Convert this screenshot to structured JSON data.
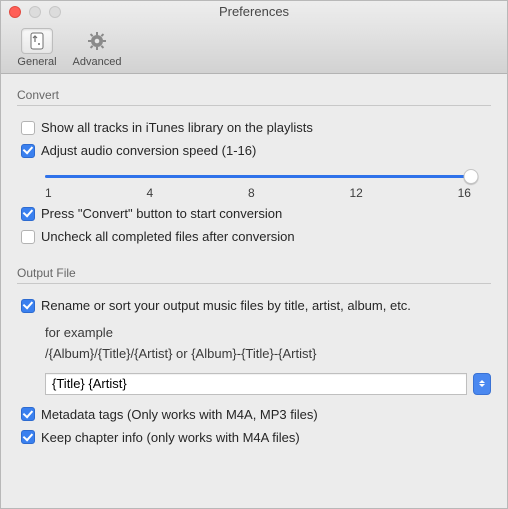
{
  "window": {
    "title": "Preferences"
  },
  "toolbar": {
    "items": [
      {
        "label": "General"
      },
      {
        "label": "Advanced"
      }
    ]
  },
  "convert": {
    "section_title": "Convert",
    "show_all": {
      "checked": false,
      "label": "Show all tracks in iTunes library on the playlists"
    },
    "adjust_speed": {
      "checked": true,
      "label": "Adjust audio conversion speed (1-16)",
      "min": 1,
      "max": 16,
      "value": 16,
      "ticks": [
        "1",
        "4",
        "8",
        "12",
        "16"
      ]
    },
    "press_convert": {
      "checked": true,
      "label": "Press \"Convert\" button to start conversion"
    },
    "uncheck_completed": {
      "checked": false,
      "label": "Uncheck all completed files after conversion"
    }
  },
  "output": {
    "section_title": "Output File",
    "rename": {
      "checked": true,
      "label": "Rename or sort your output music files by title, artist, album, etc."
    },
    "example_l1": "for example",
    "example_l2": "/{Album}/{Title}/{Artist} or {Album}-{Title}-{Artist}",
    "format_value": "{Title} {Artist}",
    "metadata": {
      "checked": true,
      "label": "Metadata tags (Only works with M4A, MP3 files)"
    },
    "chapter": {
      "checked": true,
      "label": "Keep chapter info (only works with  M4A files)"
    }
  }
}
